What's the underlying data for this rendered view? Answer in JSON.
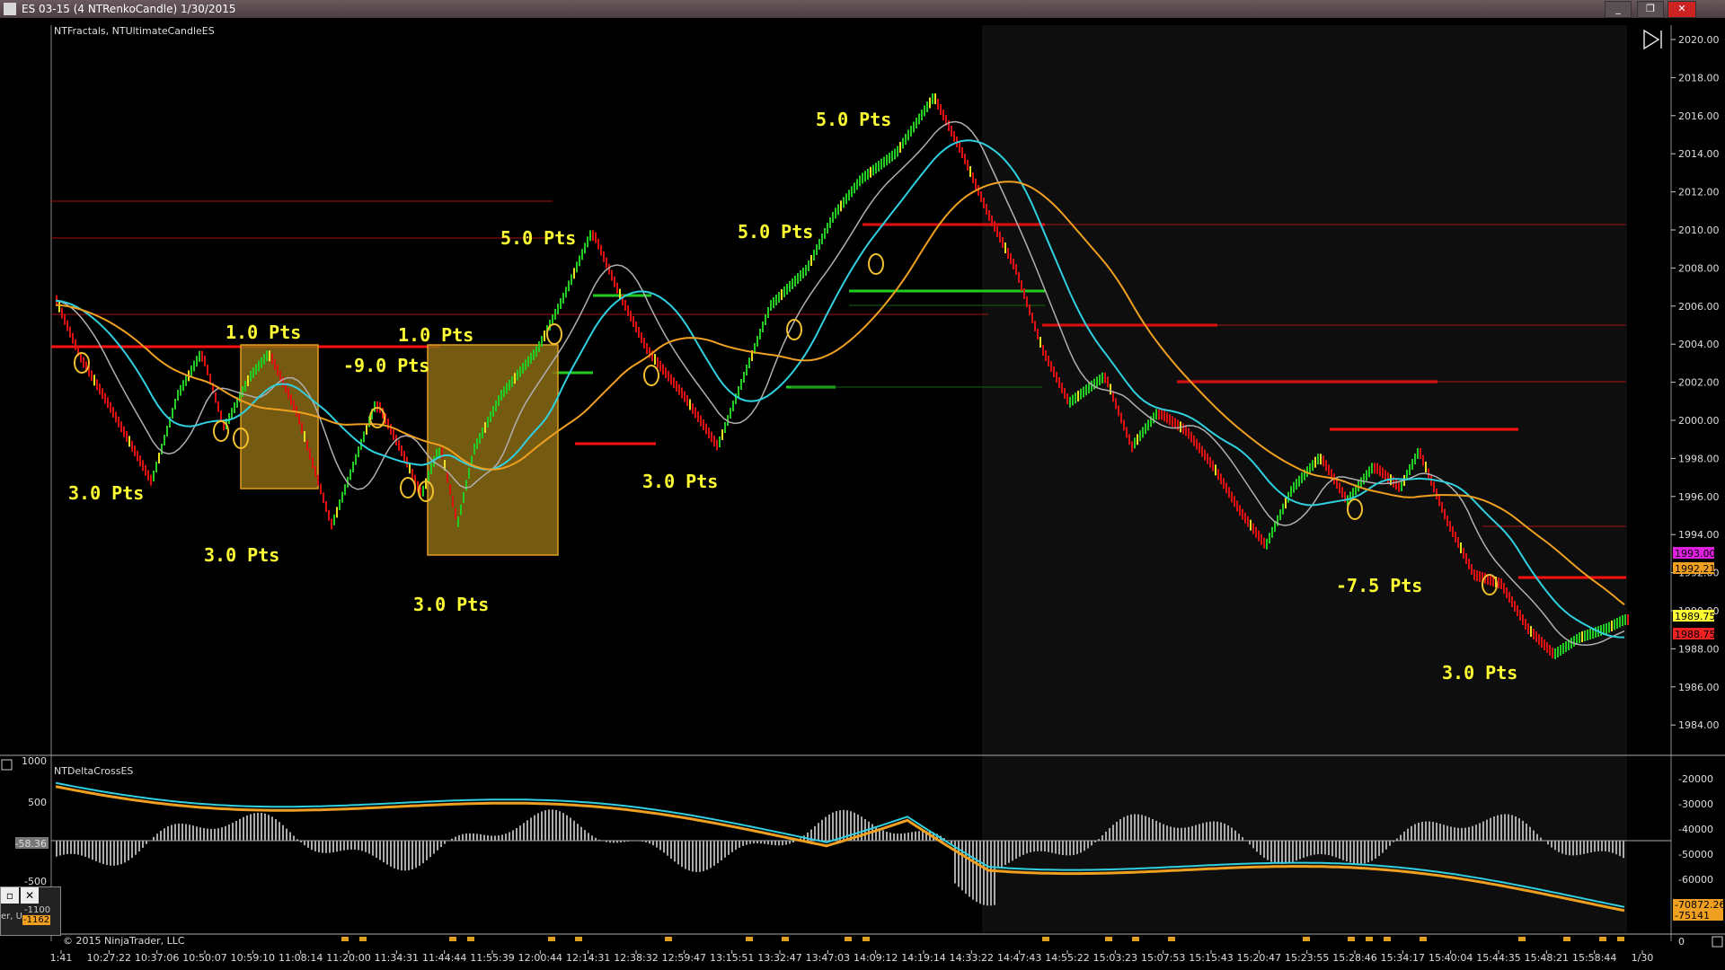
{
  "window": {
    "title": "ES 03-15 (4 NTRenkoCandle)  1/30/2015",
    "buttons": {
      "minimize": "_",
      "restore": "❐",
      "close": "✕"
    }
  },
  "main_panel": {
    "indicator_label": "NTFractals, NTUltimateCandleES",
    "price_axis": [
      "2020.00",
      "2018.00",
      "2016.00",
      "2014.00",
      "2012.00",
      "2010.00",
      "2008.00",
      "2006.00",
      "2004.00",
      "2002.00",
      "2000.00",
      "1998.00",
      "1996.00",
      "1994.00",
      "1992.00",
      "1990.00",
      "1988.00",
      "1986.00",
      "1984.00"
    ],
    "price_tags": [
      {
        "text": "1993.00",
        "color": "#e020e0"
      },
      {
        "text": "1992.21",
        "color": "#f0a020"
      },
      {
        "text": "1989.75",
        "color": "#ffff33"
      },
      {
        "text": "1988.75",
        "color": "#ee2222"
      }
    ],
    "annotations": [
      "1.0 Pts",
      "1.0 Pts",
      "-9.0 Pts",
      "3.0 Pts",
      "3.0 Pts",
      "3.0 Pts",
      "5.0 Pts",
      "5.0 Pts",
      "5.0 Pts",
      "3.0 Pts",
      "-7.5 Pts",
      "3.0 Pts"
    ]
  },
  "lower_panel": {
    "indicator_label": "NTDeltaCrossES",
    "left_axis": [
      "1000",
      "500",
      "-58.36",
      "-500"
    ],
    "right_axis": [
      "-20000",
      "-30000",
      "-40000",
      "-50000",
      "-60000"
    ],
    "tags": [
      {
        "text": "-70872.26",
        "color": "#f0a020"
      },
      {
        "text": "-75141",
        "color": "#f0a020"
      }
    ],
    "mini_window_values": [
      "-1100",
      "-1162"
    ],
    "mini_window_label": "er, U"
  },
  "footer": {
    "copyright": "© 2015 NinjaTrader, LLC",
    "time_axis": [
      "1:41",
      "10:27:22",
      "10:37:06",
      "10:50:07",
      "10:59:10",
      "11:08:14",
      "11:20:00",
      "11:34:31",
      "11:44:44",
      "11:55:39",
      "12:00:44",
      "12:14:31",
      "12:38:32",
      "12:59:47",
      "13:15:51",
      "13:32:47",
      "13:47:03",
      "14:09:12",
      "14:19:14",
      "14:33:22",
      "14:47:43",
      "14:55:22",
      "15:03:23",
      "15:07:53",
      "15:15:43",
      "15:20:47",
      "15:23:55",
      "15:28:46",
      "15:34:17",
      "15:40:04",
      "15:44:35",
      "15:48:21",
      "15:58:44",
      "1/30"
    ],
    "right_value": "0"
  },
  "colors": {
    "background": "#000000",
    "shaded_region": "#0e0e0e",
    "green_candle": "#22cc22",
    "red_candle": "#dd1111",
    "yellow_candle": "#e8e020",
    "cyan_ma": "#30d0e0",
    "orange_ma": "#f0a020",
    "gray_ma": "#b0b0b0",
    "box_fill": "#8a6a14"
  }
}
